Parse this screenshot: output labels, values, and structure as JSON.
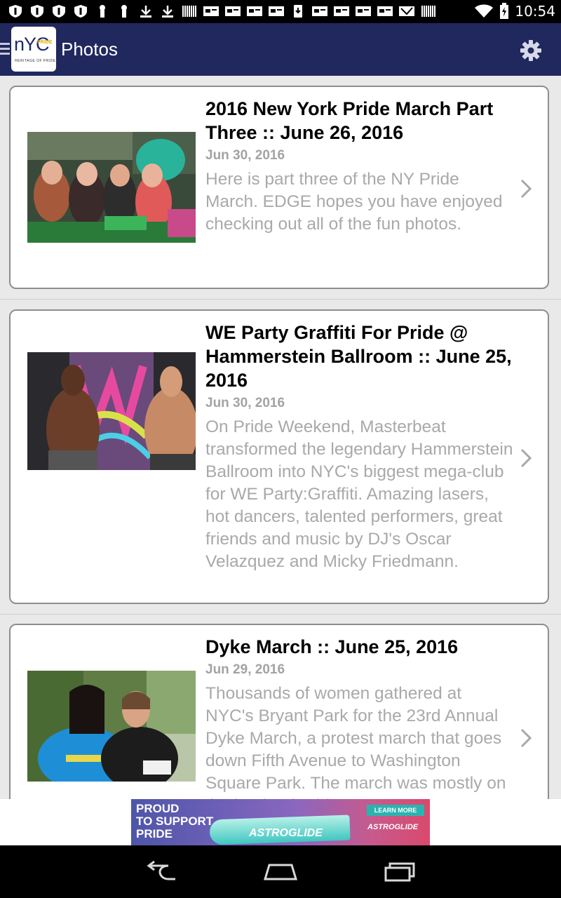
{
  "status_bar": {
    "time": "10:54",
    "notification_icons": [
      "shield-icon",
      "shield-icon",
      "shield-icon",
      "shield-icon",
      "tower-icon",
      "tower-icon",
      "download-icon",
      "download-icon",
      "barcode-icon",
      "card-icon",
      "card-icon",
      "card-icon",
      "card-icon",
      "phone-icon",
      "card-icon",
      "card-icon",
      "card-icon",
      "card-icon",
      "mail-check-icon",
      "barcode-icon"
    ]
  },
  "app_bar": {
    "title": "Photos",
    "logo": {
      "text": "nYC",
      "badge": "PRIDE",
      "subtitle": "HERITAGE OF PRIDE"
    },
    "settings_icon": "gear-icon"
  },
  "articles": [
    {
      "title": "2016 New York Pride March Part Three :: June 26, 2016",
      "date": "Jun 30, 2016",
      "description": "Here is part three of the NY Pride March. EDGE hopes you have enjoyed checking out all of the fun photos."
    },
    {
      "title": "WE Party Graffiti For Pride @ Hammerstein Ballroom :: June 25, 2016",
      "date": "Jun 30, 2016",
      "description": "On Pride Weekend, Masterbeat transformed the legendary Hammerstein Ballroom into NYC's biggest mega-club for WE Party:Graffiti. Amazing lasers, hot dancers, talented performers, great friends and music by DJ's Oscar Velazquez and Micky Friedmann."
    },
    {
      "title": "Dyke March :: June 25, 2016",
      "date": "Jun 29, 2016",
      "description": "Thousands of women gathered at NYC's Bryant Park for the 23rd Annual Dyke March, a protest march that goes down Fifth Avenue to Washington Square Park. The march was mostly on the heels of Pride"
    }
  ],
  "ad": {
    "tagline_1": "PROUD",
    "tagline_2": "TO SUPPORT",
    "tagline_3": "PRIDE",
    "product": "ASTROGLIDE",
    "cta": "LEARN MORE",
    "brand": "ASTROGLIDE"
  },
  "nav_bar": {
    "back_icon": "back-icon",
    "home_icon": "home-icon",
    "recents_icon": "recents-icon"
  },
  "colors": {
    "app_bar": "#20285e",
    "title_text": "#000000",
    "meta_text": "#a3a3a3",
    "card_border": "#8e8e8e"
  }
}
